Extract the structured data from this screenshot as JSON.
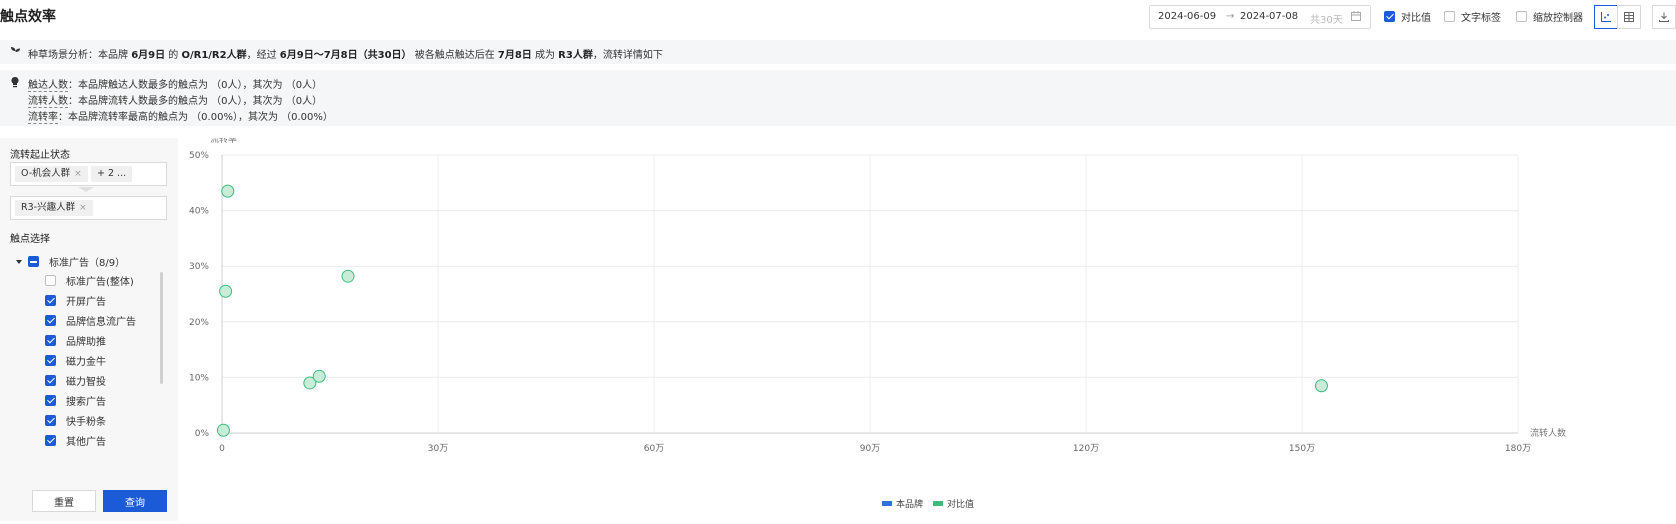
{
  "header": {
    "title": "触点效率",
    "date_start": "2024-06-09",
    "date_arrow": "→",
    "date_end": "2024-07-08",
    "date_span": "共30天",
    "options": [
      {
        "label": "对比值",
        "checked": true
      },
      {
        "label": "文字标签",
        "checked": false
      },
      {
        "label": "缩放控制器",
        "checked": false
      }
    ],
    "icons": [
      "scatter-chart-icon",
      "table-icon",
      "download-icon"
    ]
  },
  "banner": {
    "p1": "种草场景分析：本品牌 ",
    "b1": "6月9日",
    "p2": " 的 ",
    "b2": "O/R1/R2人群",
    "p3": "，经过 ",
    "b3": "6月9日～7月8日（共30日）",
    "p4": " 被各触点触达后在 ",
    "b4": "7月8日",
    "p5": " 成为 ",
    "b5": "R3人群",
    "p6": "，流转详情如下"
  },
  "insight": {
    "lines": [
      {
        "term": "触达人数",
        "text": "：本品牌触达人数最多的触点为 （0人），其次为 （0人）"
      },
      {
        "term": "流转人数",
        "text": "：本品牌流转人数最多的触点为 （0人），其次为 （0人）"
      },
      {
        "term": "流转率",
        "text": "：本品牌流转率最高的触点为 （0.00%），其次为 （0.00%）"
      }
    ]
  },
  "sidebar": {
    "flow_title": "流转起止状态",
    "from_tag": "O-机会人群",
    "from_more": "+ 2 ...",
    "to_tag": "R3-兴趣人群",
    "touch_title": "触点选择",
    "group": {
      "label": "标准广告（8/9）"
    },
    "items": [
      {
        "label": "标准广告(整体)",
        "checked": false
      },
      {
        "label": "开屏广告",
        "checked": true
      },
      {
        "label": "品牌信息流广告",
        "checked": true
      },
      {
        "label": "品牌助推",
        "checked": true
      },
      {
        "label": "磁力金牛",
        "checked": true
      },
      {
        "label": "磁力智投",
        "checked": true
      },
      {
        "label": "搜索广告",
        "checked": true
      },
      {
        "label": "快手粉条",
        "checked": true
      },
      {
        "label": "其他广告",
        "checked": true
      }
    ],
    "reset_label": "重置",
    "query_label": "查询"
  },
  "chart_data": {
    "type": "scatter",
    "title": "",
    "xlabel": "流转人数",
    "ylabel": "流转率",
    "xlim": [
      0,
      1800000
    ],
    "ylim": [
      0,
      50
    ],
    "xticks": [
      0,
      300000,
      600000,
      900000,
      1200000,
      1500000,
      1800000
    ],
    "xtick_labels": [
      "0",
      "30万",
      "60万",
      "90万",
      "120万",
      "150万",
      "180万"
    ],
    "yticks": [
      0,
      10,
      20,
      30,
      40,
      50
    ],
    "ytick_labels": [
      "0%",
      "10%",
      "20%",
      "30%",
      "40%",
      "50%"
    ],
    "grid": true,
    "legend_position": "bottom-center",
    "series": [
      {
        "name": "本品牌",
        "color": "#2f6fe4",
        "points": []
      },
      {
        "name": "对比值",
        "color": "#3dbb7d",
        "points": [
          {
            "x": 8000,
            "y": 43.5
          },
          {
            "x": 5000,
            "y": 25.5
          },
          {
            "x": 175000,
            "y": 28.2
          },
          {
            "x": 122000,
            "y": 9.0
          },
          {
            "x": 135000,
            "y": 10.2
          },
          {
            "x": 2000,
            "y": 0.5
          },
          {
            "x": 1527000,
            "y": 8.5
          }
        ]
      }
    ]
  }
}
